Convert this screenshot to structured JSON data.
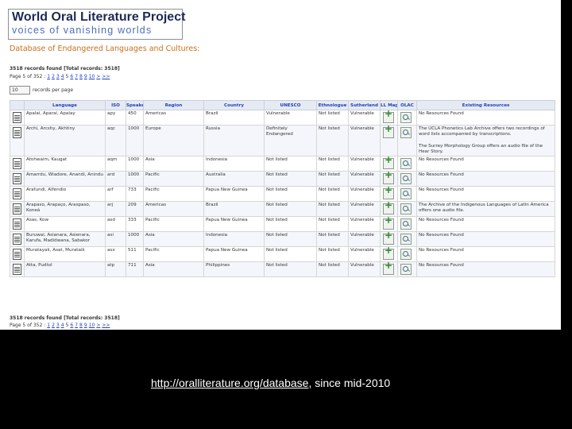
{
  "header": {
    "logo_title": "World Oral Literature Project",
    "logo_subtitle": "voices of vanishing worlds",
    "db_title": "Database of Endangered Languages and Cultures:"
  },
  "records_line": "3518 records found  [Total records: 3518]",
  "pager": {
    "label": "Page 5 of 352 :",
    "links": [
      "1",
      "2",
      "3",
      "4"
    ],
    "current": "5",
    "more_links": [
      "6",
      "7",
      "8",
      "9",
      "10",
      ">",
      ">>"
    ]
  },
  "per_page": {
    "value": "10",
    "label": "records per page"
  },
  "table": {
    "headers": [
      "",
      "Language",
      "ISO",
      "Speakers",
      "Region",
      "Country",
      "UNESCO",
      "Ethnologue",
      "Sutherland",
      "LL Map",
      "OLAC",
      "Existing Resources"
    ],
    "rows": [
      {
        "language": "Apalaí, Aparaí, Apalay",
        "iso": "apy",
        "speakers": "450",
        "region": "Americas",
        "country": "Brazil",
        "unesco": "Vulnerable",
        "unesco_status": "vul",
        "ethnologue": "Not listed",
        "sutherland": "Vulnerable",
        "resources": "No Resources Found"
      },
      {
        "language": "Archi, Arcshy, Akhtiny",
        "iso": "aqc",
        "speakers": "1000",
        "region": "Europe",
        "country": "Russia",
        "unesco": "Definitely Endangered",
        "unesco_status": "eng",
        "ethnologue": "Not listed",
        "sutherland": "Vulnerable",
        "resources": "The UCLA Phonetics Lab Archive offers two recordings of word lists accompanied by transcriptions.",
        "resources_extra": "The Surrey Morphology Group offers an audio file of the Hear Story."
      },
      {
        "language": "Atohwaim, Kaugat",
        "iso": "aqm",
        "speakers": "1000",
        "region": "Asia",
        "country": "Indonesia",
        "unesco": "Not listed",
        "unesco_status": "not",
        "ethnologue": "Not listed",
        "sutherland": "Vulnerable",
        "resources": "No Resources Found"
      },
      {
        "language": "Amarrdu, Wiadore, Anandi, Anindu",
        "iso": "ard",
        "speakers": "1000",
        "region": "Pacific",
        "country": "Australia",
        "unesco": "Not listed",
        "unesco_status": "not",
        "ethnologue": "Not listed",
        "sutherland": "Vulnerable",
        "resources": "No Resources Found"
      },
      {
        "language": "Arafundi, Alfendio",
        "iso": "arf",
        "speakers": "733",
        "region": "Pacific",
        "country": "Papua New Guinea",
        "unesco": "Not listed",
        "unesco_status": "not",
        "ethnologue": "Not listed",
        "sutherland": "Vulnerable",
        "resources": "No Resources Found"
      },
      {
        "language": "Arapaso, Arapaço, Araspaso, Koneá",
        "iso": "arj",
        "speakers": "209",
        "region": "Americas",
        "country": "Brazil",
        "unesco": "Not listed",
        "unesco_status": "not",
        "ethnologue": "Not listed",
        "sutherland": "Vulnerable",
        "resources": "The Archive of the Indigenous Languages of Latin America offers one audio file."
      },
      {
        "language": "Asas, Kow",
        "iso": "asd",
        "speakers": "333",
        "region": "Pacific",
        "country": "Papua New Guinea",
        "unesco": "Not listed",
        "unesco_status": "not",
        "ethnologue": "Not listed",
        "sutherland": "Vulnerable",
        "resources": "No Resources Found"
      },
      {
        "language": "Buruwai, Asianara, Asienara, Karufa, Madidwana, Sabakor",
        "iso": "asi",
        "speakers": "1000",
        "region": "Asia",
        "country": "Indonesia",
        "unesco": "Not listed",
        "unesco_status": "not",
        "ethnologue": "Not listed",
        "sutherland": "Vulnerable",
        "resources": "No Resources Found"
      },
      {
        "language": "Muratayak, Asat, Murataik",
        "iso": "asx",
        "speakers": "511",
        "region": "Pacific",
        "country": "Papua New Guinea",
        "unesco": "Not listed",
        "unesco_status": "not",
        "ethnologue": "Not listed",
        "sutherland": "Vulnerable",
        "resources": "No Resources Found"
      },
      {
        "language": "Atta, Pudtol",
        "iso": "atp",
        "speakers": "711",
        "region": "Asia",
        "country": "Philippines",
        "unesco": "Not listed",
        "unesco_status": "not",
        "ethnologue": "Not listed",
        "sutherland": "Vulnerable",
        "resources": "No Resources Found"
      }
    ]
  },
  "caption": {
    "url": "http://oralliterature.org/database",
    "suffix": ", since mid-2010"
  },
  "colors": {
    "unesco_endangered": "#d47a19",
    "vulnerable": "#c89a1a",
    "link": "#1f3fbf",
    "logo": "#1d2a55"
  }
}
